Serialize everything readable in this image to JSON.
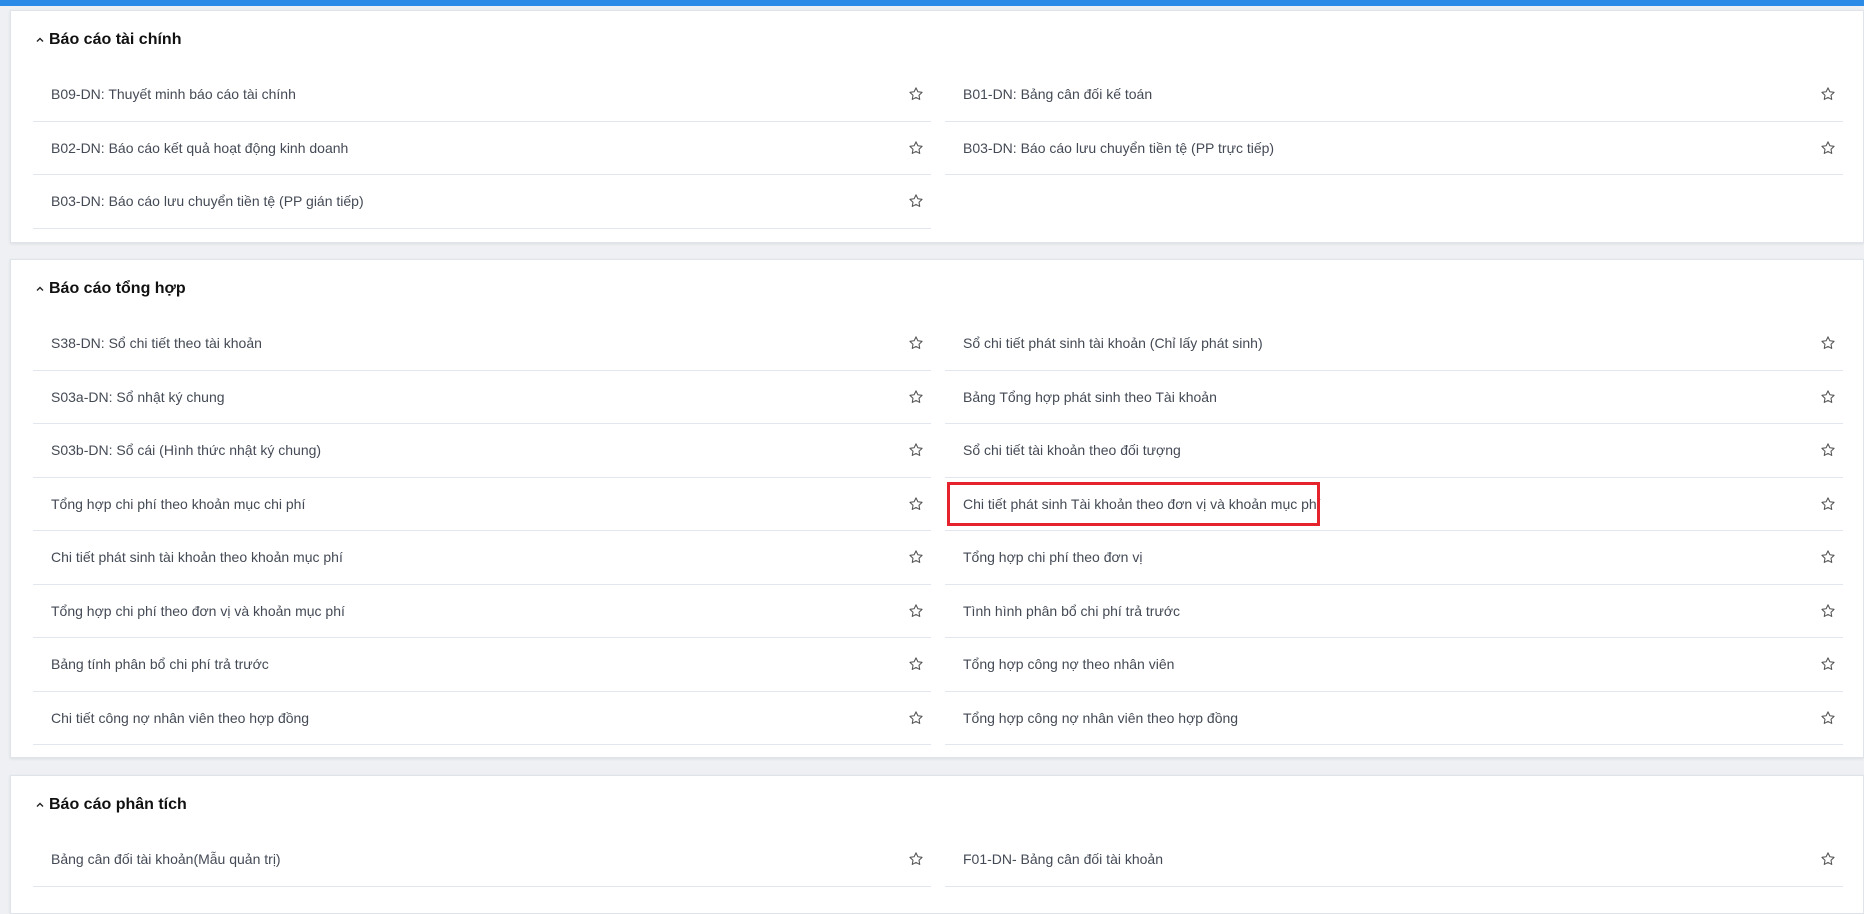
{
  "sections": [
    {
      "title": "Báo cáo tài chính",
      "items": [
        "B09-DN: Thuyết minh báo cáo tài chính",
        "B01-DN: Bảng cân đối kế toán",
        "B02-DN: Báo cáo kết quả hoạt động kinh doanh",
        "B03-DN: Báo cáo lưu chuyển tiền tệ (PP trực tiếp)",
        "B03-DN: Báo cáo lưu chuyển tiền tệ (PP gián tiếp)"
      ]
    },
    {
      "title": "Báo cáo tổng hợp",
      "items": [
        "S38-DN: Sổ chi tiết theo tài khoản",
        "Sổ chi tiết phát sinh tài khoản (Chỉ lấy phát sinh)",
        "S03a-DN: Sổ nhật ký chung",
        "Bảng Tổng hợp phát sinh theo Tài khoản",
        "S03b-DN: Sổ cái (Hình thức nhật ký chung)",
        "Sổ chi tiết tài khoản theo đối tượng",
        "Tổng hợp chi phí theo khoản mục chi phí",
        "Chi tiết phát sinh Tài khoản theo đơn vị và khoản mục phí",
        "Chi tiết phát sinh tài khoản theo khoản mục phí",
        "Tổng hợp chi phí theo đơn vị",
        "Tổng hợp chi phí theo đơn vị và khoản mục phí",
        "Tình hình phân bổ chi phí trả trước",
        "Bảng tính phân bổ chi phí trả trước",
        "Tổng hợp công nợ theo nhân viên",
        "Chi tiết công nợ nhân viên theo hợp đồng",
        "Tổng hợp công nợ nhân viên theo hợp đồng"
      ]
    },
    {
      "title": "Báo cáo phân tích",
      "items": [
        "Bảng cân đối tài khoản(Mẫu quản trị)",
        "F01-DN- Bảng cân đối tài khoản"
      ]
    }
  ],
  "icons": {
    "collapse": "chevron-up-icon",
    "favorite": "star-outline-icon"
  },
  "colors": {
    "accent": "#2b8be6",
    "highlight": "#e5232d"
  }
}
